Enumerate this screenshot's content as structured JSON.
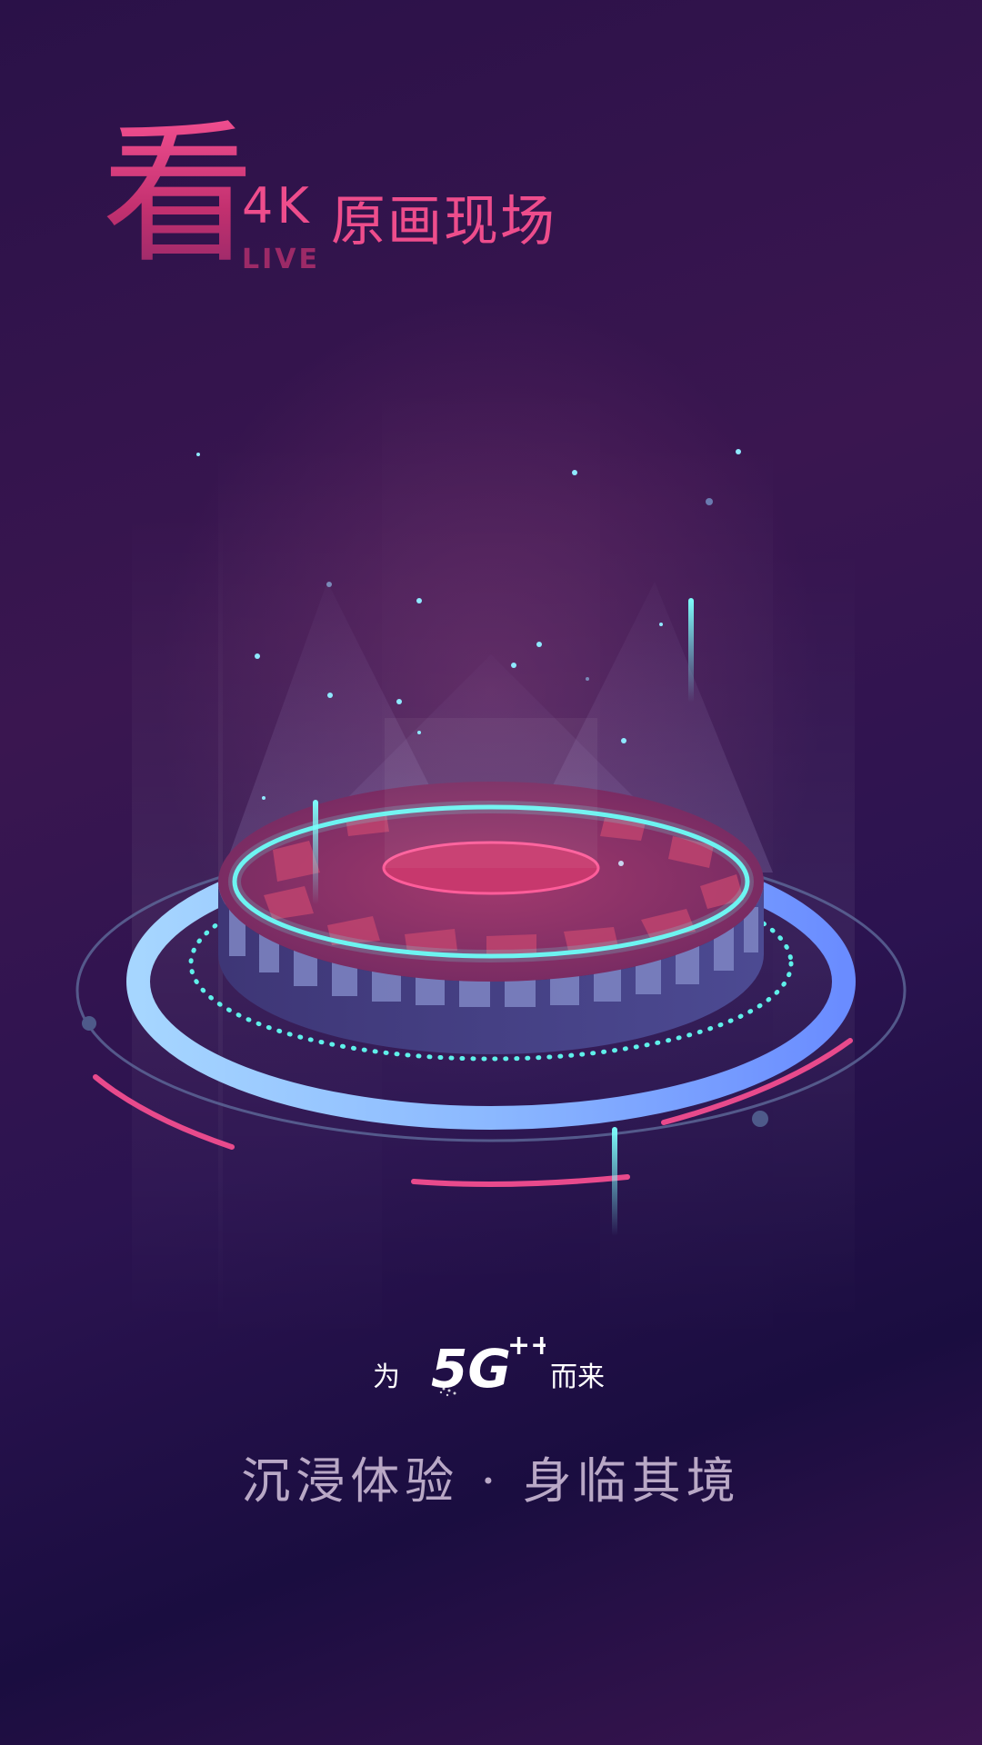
{
  "poster": {
    "title_big_char": "看",
    "title_4k": "4K",
    "title_cn": "原画现场",
    "title_live": "LIVE",
    "brand_left": "为",
    "brand_logo_text": "5G",
    "brand_logo_superscript": "++",
    "brand_right": "而来",
    "tagline": "沉浸体验 · 身临其境"
  },
  "colors": {
    "accent_pink": "#ee4d8c",
    "accent_cyan": "#6df4f2",
    "ring_blue": "#79b9ff",
    "tagline": "#b9a8c6"
  }
}
